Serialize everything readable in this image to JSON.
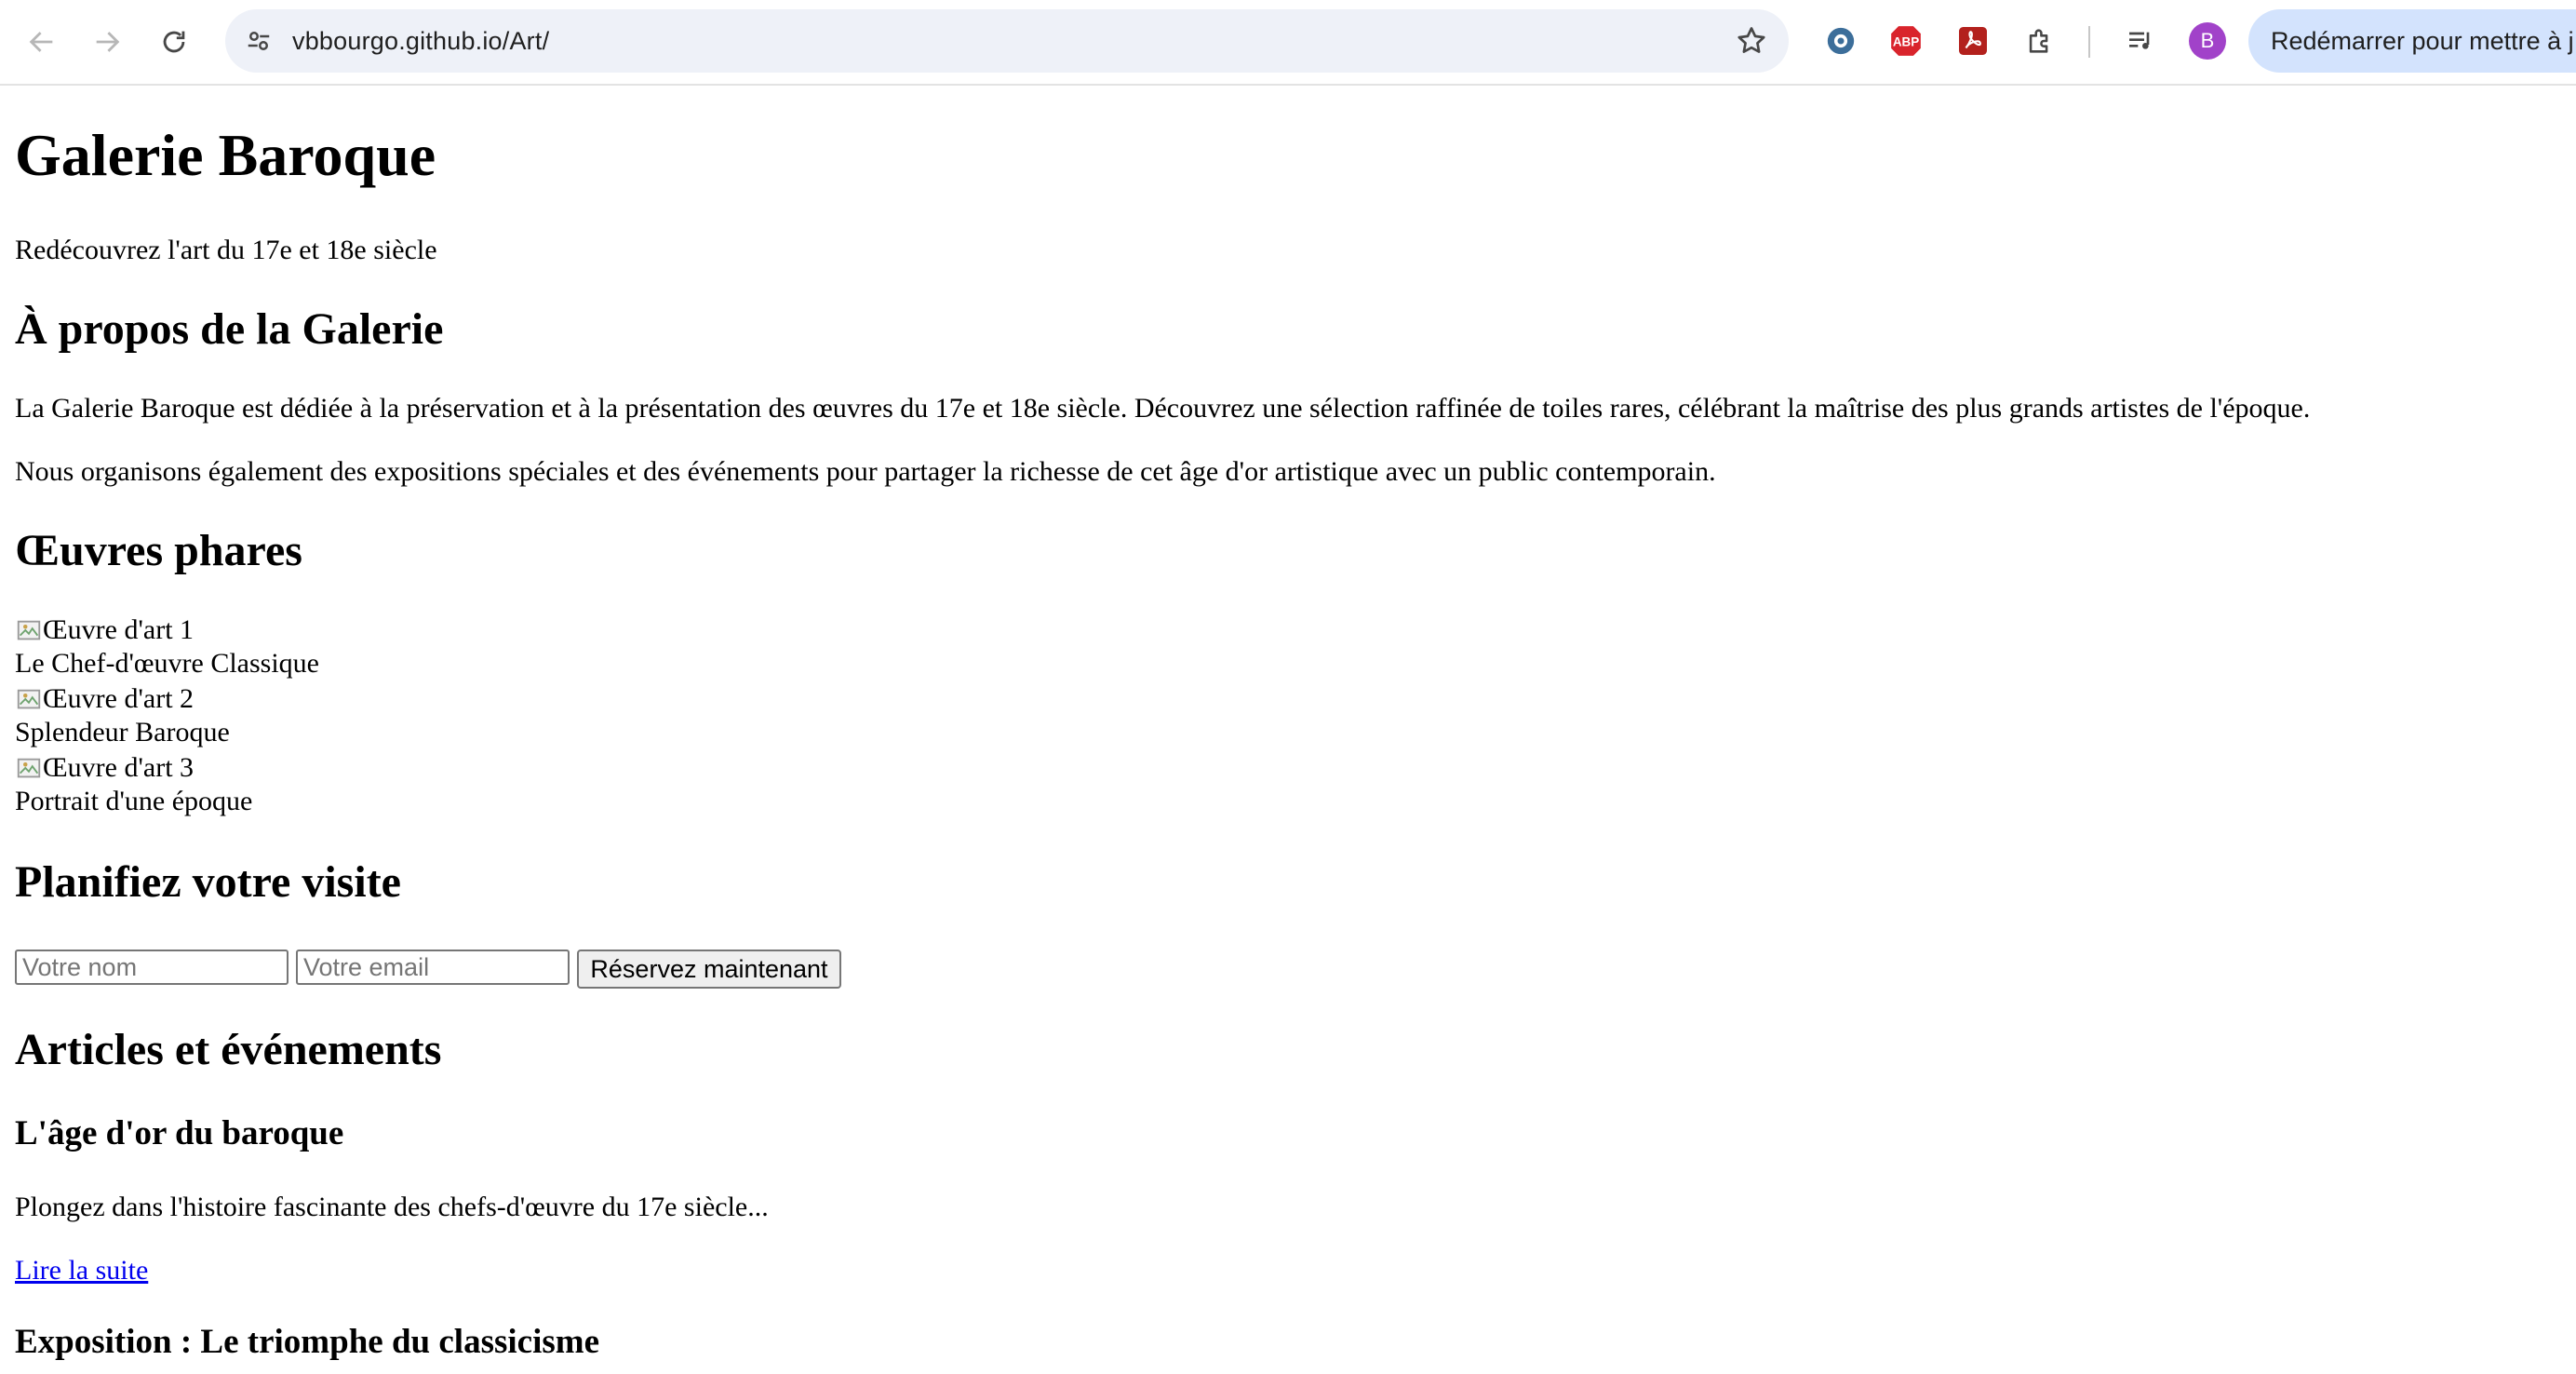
{
  "browser": {
    "url": "vbbourgo.github.io/Art/",
    "avatar_initial": "B",
    "update_button": "Redémarrer pour mettre à j",
    "extensions": [
      "ext-puzzle-bubble-icon",
      "adblock-plus-icon",
      "pdf-icon",
      "extensions-icon",
      "media-queue-icon"
    ],
    "abp_label": "ABP"
  },
  "page": {
    "title": "Galerie Baroque",
    "subtitle": "Redécouvrez l'art du 17e et 18e siècle",
    "about": {
      "heading": "À propos de la Galerie",
      "paragraph1": "La Galerie Baroque est dédiée à la préservation et à la présentation des œuvres du 17e et 18e siècle. Découvrez une sélection raffinée de toiles rares, célébrant la maîtrise des plus grands artistes de l'époque.",
      "paragraph2": "Nous organisons également des expositions spéciales et des événements pour partager la richesse de cet âge d'or artistique avec un public contemporain."
    },
    "featured": {
      "heading": "Œuvres phares",
      "items": [
        {
          "alt": "Œuvre d'art 1",
          "caption": "Le Chef-d'œuvre Classique"
        },
        {
          "alt": "Œuvre d'art 2",
          "caption": "Splendeur Baroque"
        },
        {
          "alt": "Œuvre d'art 3",
          "caption": "Portrait d'une époque"
        }
      ]
    },
    "visit": {
      "heading": "Planifiez votre visite",
      "name_placeholder": "Votre nom",
      "email_placeholder": "Votre email",
      "submit_label": "Réservez maintenant"
    },
    "articles": {
      "heading": "Articles et événements",
      "items": [
        {
          "title": "L'âge d'or du baroque",
          "excerpt": "Plongez dans l'histoire fascinante des chefs-d'œuvre du 17e siècle...",
          "link": "Lire la suite"
        },
        {
          "title": "Exposition : Le triomphe du classicisme"
        }
      ]
    }
  }
}
